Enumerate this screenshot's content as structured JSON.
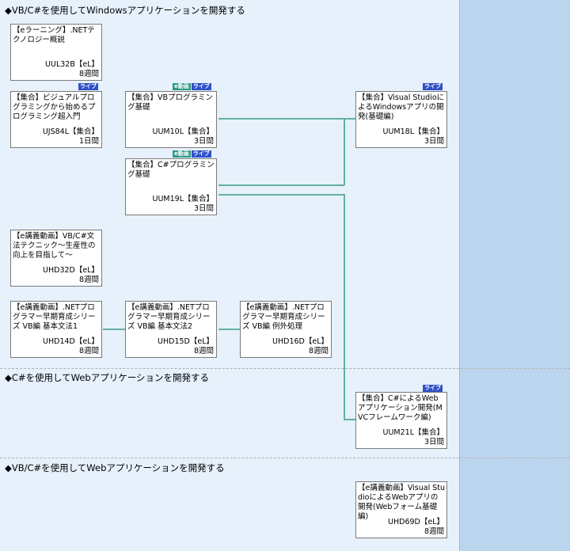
{
  "sections": [
    {
      "title": "◆VB/C#を使用してWindowsアプリケーションを開発する"
    },
    {
      "title": "◆C#を使用してWebアプリケーションを開発する"
    },
    {
      "title": "◆VB/C#を使用してWebアプリケーションを開発する"
    }
  ],
  "badges": {
    "live": "ライブ",
    "edouga": "e動画"
  },
  "cards": [
    {
      "title": "【eラーニング】.NETテクノロジー概説",
      "code": "UUL32B【eL】",
      "duration": "8週間"
    },
    {
      "title": "【集合】ビジュアルプログラミングから始めるプログラミング超入門",
      "code": "UJS84L【集合】",
      "duration": "1日間"
    },
    {
      "title": "【集合】VBプログラミング基礎",
      "code": "UUM10L【集合】",
      "duration": "3日間"
    },
    {
      "title": "【集合】C#プログラミング基礎",
      "code": "UUM19L【集合】",
      "duration": "3日間"
    },
    {
      "title": "【集合】Visual StudioによるWindowsアプリの開発(基礎編)",
      "code": "UUM18L【集合】",
      "duration": "3日間"
    },
    {
      "title": "【e講義動画】VB/C#文法テクニック～生産性の向上を目指して～",
      "code": "UHD32D【eL】",
      "duration": "8週間"
    },
    {
      "title": "【e講義動画】.NETプログラマー早期育成シリーズ VB編 基本文法1",
      "code": "UHD14D【eL】",
      "duration": "8週間"
    },
    {
      "title": "【e講義動画】.NETプログラマー早期育成シリーズ VB編 基本文法2",
      "code": "UHD15D【eL】",
      "duration": "8週間"
    },
    {
      "title": "【e講義動画】.NETプログラマー早期育成シリーズ VB編 例外処理",
      "code": "UHD16D【eL】",
      "duration": "8週間"
    },
    {
      "title": "【集合】C#によるWebアプリケーション開発(MVCフレームワーク編)",
      "code": "UUM21L【集合】",
      "duration": "3日間"
    },
    {
      "title": "【e講義動画】Visual StudioによるWebアプリの開発(Webフォーム基礎編)",
      "code": "UHD69D【eL】",
      "duration": "8週間"
    }
  ],
  "colors": {
    "background": "#e6f1fc",
    "right_band": "#bcd5ef",
    "connector": "#3a9a7e",
    "live_badge": "#2f52c9",
    "edouga_badge": "#2c9a86"
  }
}
